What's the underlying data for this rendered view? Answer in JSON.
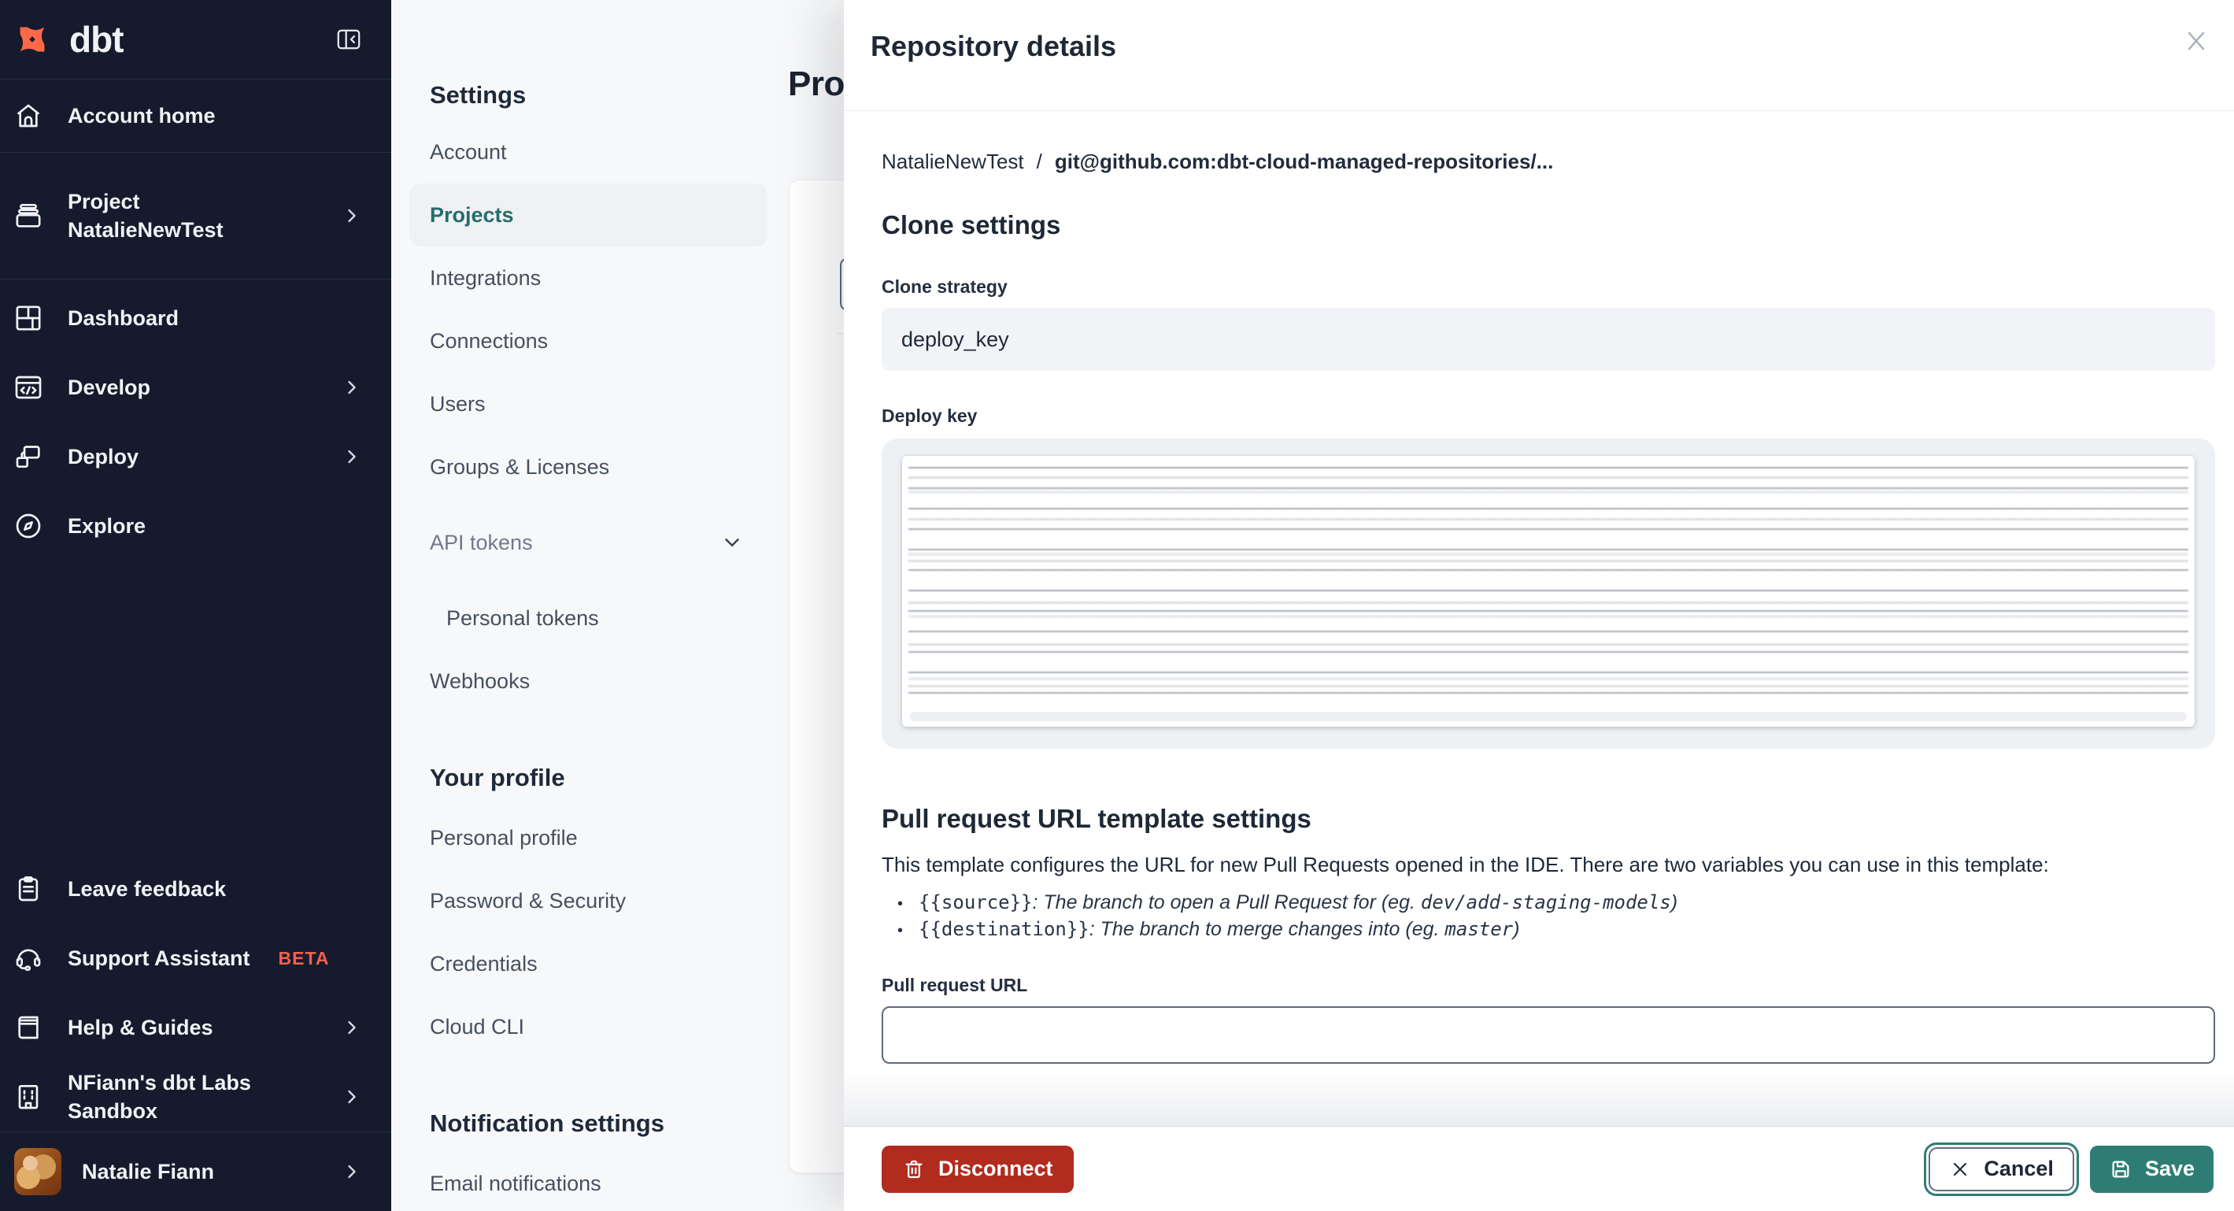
{
  "colors": {
    "color-sidebar": "#151B2D",
    "color-accent": "#2E7D74",
    "color-accent-text": "#266B6D",
    "color-danger": "#B22B1F",
    "color-beta": "#F4604B",
    "color-logo": "#FF6947"
  },
  "sidebar": {
    "logo_text": "dbt",
    "items": [
      {
        "label": "Account home",
        "icon": "home-icon"
      },
      {
        "label": "Project",
        "label2": "NatalieNewTest",
        "icon": "archive-icon"
      },
      {
        "label": "Dashboard",
        "icon": "dashboard-icon"
      },
      {
        "label": "Develop",
        "icon": "code-window-icon"
      },
      {
        "label": "Deploy",
        "icon": "deploy-icon"
      },
      {
        "label": "Explore",
        "icon": "compass-icon"
      }
    ],
    "footer_items": [
      {
        "label": "Leave feedback",
        "icon": "clipboard-icon"
      },
      {
        "label": "Support Assistant",
        "badge": "BETA",
        "icon": "headset-icon"
      },
      {
        "label": "Help & Guides",
        "icon": "book-icon"
      },
      {
        "label": "NFiann's dbt Labs Sandbox",
        "icon": "building-icon"
      }
    ],
    "user": {
      "name": "Natalie Fiann"
    }
  },
  "settings_nav": {
    "heading": "Settings",
    "items": [
      {
        "label": "Account"
      },
      {
        "label": "Projects"
      },
      {
        "label": "Integrations"
      },
      {
        "label": "Connections"
      },
      {
        "label": "Users"
      },
      {
        "label": "Groups & Licenses"
      },
      {
        "label": "API tokens"
      },
      {
        "label": "Personal tokens"
      },
      {
        "label": "Webhooks"
      }
    ],
    "profile_heading": "Your profile",
    "profile_items": [
      {
        "label": "Personal profile"
      },
      {
        "label": "Password & Security"
      },
      {
        "label": "Credentials"
      },
      {
        "label": "Cloud CLI"
      }
    ],
    "notifications_heading": "Notification settings",
    "notification_items": [
      {
        "label": "Email notifications"
      }
    ]
  },
  "page": {
    "title": "Projects"
  },
  "modal": {
    "title": "Repository details",
    "breadcrumb": {
      "project": "NatalieNewTest",
      "separator": "/",
      "repo": "git@github.com:dbt-cloud-managed-repositories/..."
    },
    "clone": {
      "heading": "Clone settings",
      "strategy_label": "Clone strategy",
      "strategy_value": "deploy_key",
      "deploy_key_label": "Deploy key"
    },
    "pr": {
      "heading": "Pull request URL template settings",
      "description": "This template configures the URL for new Pull Requests opened in the IDE. There are two variables you can use in this template:",
      "bullets": [
        {
          "code": "{{source}}",
          "text": ": The branch to open a Pull Request for (eg. ",
          "example": "dev/add-staging-models",
          "close": ")"
        },
        {
          "code": "{{destination}}",
          "text": ": The branch to merge changes into (eg. ",
          "example": "master",
          "close": ")"
        }
      ],
      "url_label": "Pull request URL",
      "url_value": ""
    },
    "footer": {
      "disconnect": "Disconnect",
      "cancel": "Cancel",
      "save": "Save"
    }
  }
}
